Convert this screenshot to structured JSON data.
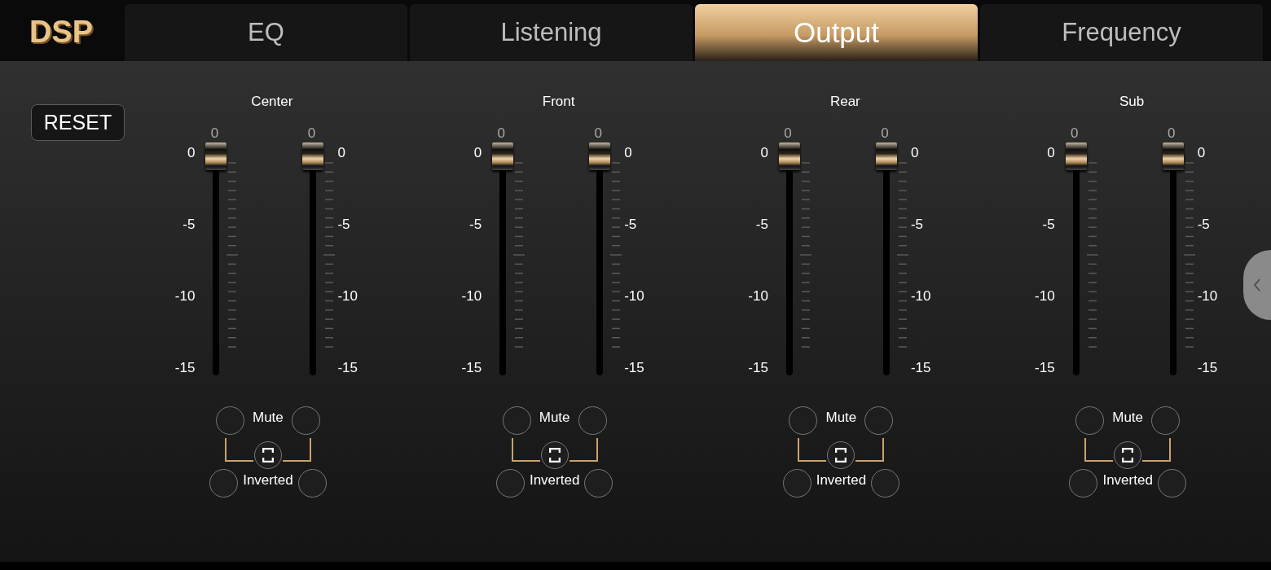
{
  "logo": "DSP",
  "tabs": [
    {
      "label": "EQ",
      "selected": false
    },
    {
      "label": "Listening",
      "selected": false
    },
    {
      "label": "Output",
      "selected": true
    },
    {
      "label": "Frequency",
      "selected": false
    }
  ],
  "reset_button": "RESET",
  "channels": [
    {
      "name": "Center",
      "mute_label": "Mute",
      "invert_label": "Inverted",
      "faders": [
        {
          "value": "0",
          "level": 1,
          "scale": [
            "0",
            "-5",
            "-10",
            "-15"
          ]
        },
        {
          "value": "0",
          "level": 1,
          "scale": [
            "0",
            "-5",
            "-10",
            "-15"
          ]
        }
      ]
    },
    {
      "name": "Front",
      "mute_label": "Mute",
      "invert_label": "Inverted",
      "faders": [
        {
          "value": "0",
          "level": 1,
          "scale": [
            "0",
            "-5",
            "-10",
            "-15"
          ]
        },
        {
          "value": "0",
          "level": 1,
          "scale": [
            "0",
            "-5",
            "-10",
            "-15"
          ]
        }
      ]
    },
    {
      "name": "Rear",
      "mute_label": "Mute",
      "invert_label": "Inverted",
      "faders": [
        {
          "value": "0",
          "level": 1,
          "scale": [
            "0",
            "-5",
            "-10",
            "-15"
          ]
        },
        {
          "value": "0",
          "level": 1,
          "scale": [
            "0",
            "-5",
            "-10",
            "-15"
          ]
        }
      ]
    },
    {
      "name": "Sub",
      "mute_label": "Mute",
      "invert_label": "Inverted",
      "faders": [
        {
          "value": "0",
          "level": 1,
          "scale": [
            "0",
            "-5",
            "-10",
            "-15"
          ]
        },
        {
          "value": "0",
          "level": 1,
          "scale": [
            "0",
            "-5",
            "-10",
            "-15"
          ]
        }
      ]
    }
  ]
}
